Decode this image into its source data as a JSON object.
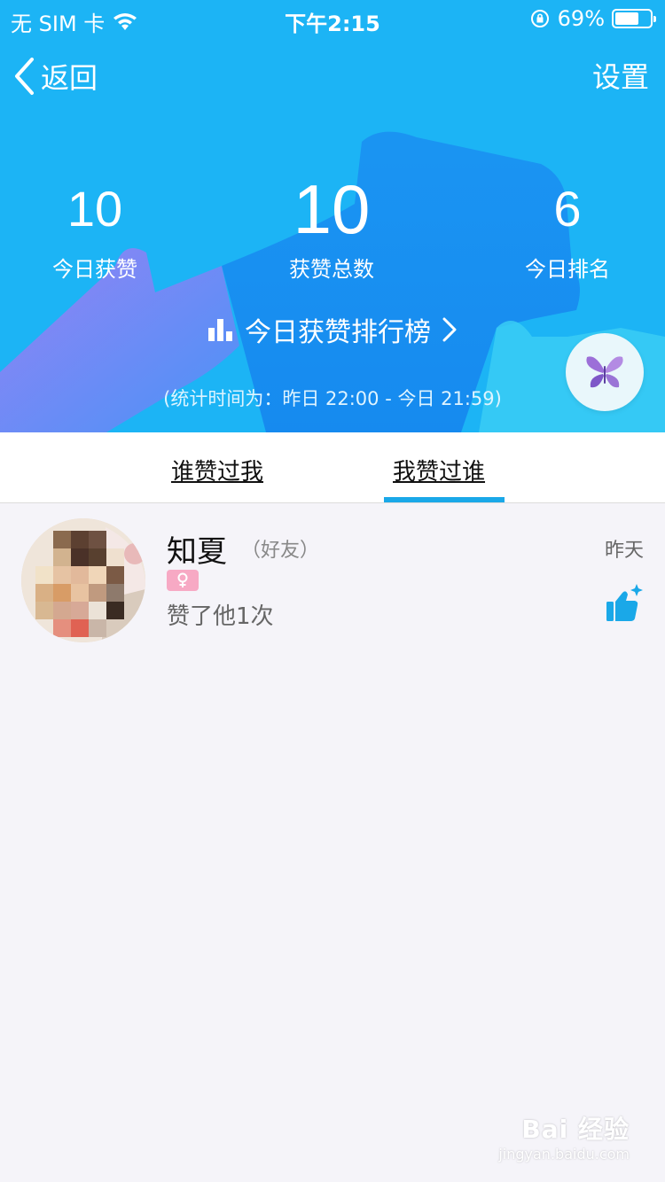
{
  "status_bar": {
    "carrier": "无 SIM 卡",
    "time": "下午2:15",
    "battery": "69%",
    "battery_level": 0.69
  },
  "nav": {
    "back_label": "返回",
    "settings_label": "设置"
  },
  "stats": [
    {
      "value": "10",
      "label": "今日获赞"
    },
    {
      "value": "10",
      "label": "获赞总数"
    },
    {
      "value": "6",
      "label": "今日排名"
    }
  ],
  "ranking": {
    "link_label": "今日获赞排行榜",
    "period": "(统计时间为：昨日 22:00 - 今日 21:59)"
  },
  "tabs": [
    {
      "label": "谁赞过我",
      "active": false
    },
    {
      "label": "我赞过谁",
      "active": true
    }
  ],
  "list": [
    {
      "name": "知夏",
      "tag": "（好友）",
      "desc": "赞了他1次",
      "time": "昨天",
      "gender": "female"
    }
  ],
  "watermark": {
    "main": "Bai 经验",
    "sub": "jingyan.baidu.com"
  },
  "colors": {
    "header_bg": "#1cb4f5",
    "accent": "#1aa8e8",
    "gender_female": "#f7a9c4",
    "page_bg": "#f5f4f9"
  },
  "icons": {
    "back": "chevron-left-icon",
    "wifi": "wifi-icon",
    "lock_rotation": "orientation-lock-icon",
    "battery": "battery-icon",
    "ranking": "bar-chart-icon",
    "chevron": "chevron-right-icon",
    "floating_avatar": "butterfly-icon",
    "gender": "female-icon",
    "like": "thumbs-up-icon"
  }
}
